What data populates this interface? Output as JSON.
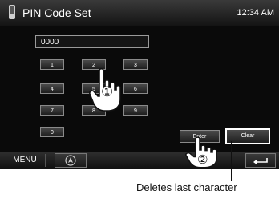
{
  "header": {
    "title": "PIN Code Set",
    "clock": "12:34 AM"
  },
  "pin_field": {
    "value": "0000"
  },
  "keypad": {
    "keys": [
      "1",
      "2",
      "3",
      "4",
      "5",
      "6",
      "7",
      "8",
      "9",
      "0"
    ]
  },
  "actions": {
    "enter_label": "Enter",
    "clear_label": "Clear"
  },
  "bottom_bar": {
    "menu_label": "MENU"
  },
  "annotations": {
    "step1": "①",
    "step2": "②",
    "caption": "Deletes last character"
  },
  "colors": {
    "screen_bg": "#0a0a0a",
    "button_border": "#8a8a8a",
    "text": "#ffffff"
  }
}
